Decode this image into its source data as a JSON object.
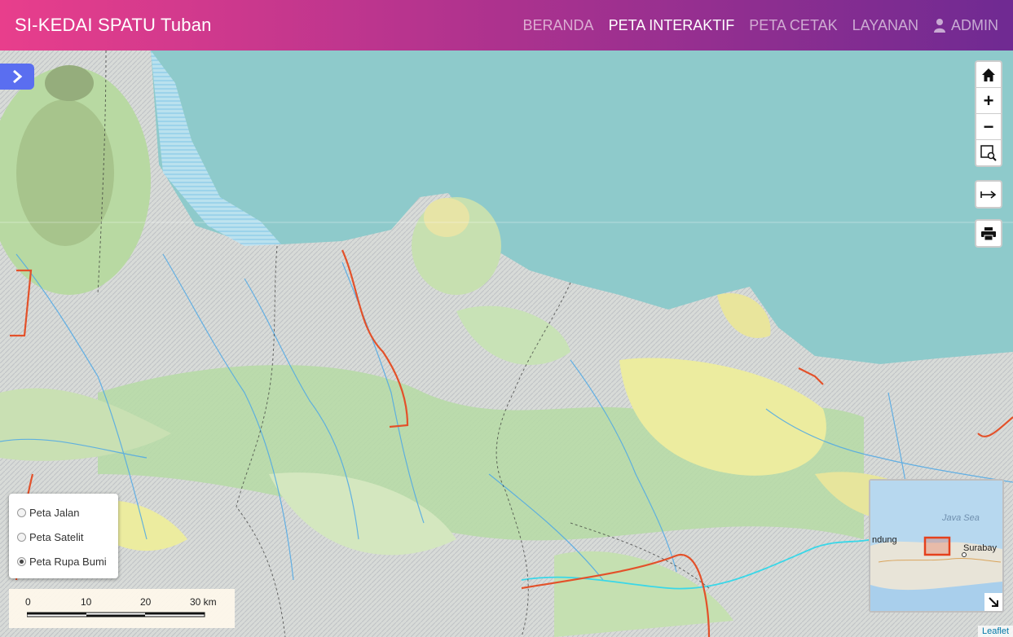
{
  "navbar": {
    "brand": "SI-KEDAI SPATU Tuban",
    "items": [
      {
        "label": "BERANDA",
        "active": false
      },
      {
        "label": "PETA INTERAKTIF",
        "active": true
      },
      {
        "label": "PETA CETAK",
        "active": false
      },
      {
        "label": "LAYANAN",
        "active": false
      },
      {
        "label": "ADMIN",
        "active": false,
        "icon": "user-icon"
      }
    ],
    "colors": {
      "gradient_start": "#e83e8c",
      "gradient_end": "#6f2a92"
    }
  },
  "map": {
    "sidebar_toggle_icon": "chevron-right-icon",
    "controls": {
      "home_icon": "home-icon",
      "zoom_in": "+",
      "zoom_out": "−",
      "zoom_box_icon": "zoom-box-icon",
      "measure_icon": "arrow-right-icon",
      "print_icon": "printer-icon"
    },
    "layers": [
      {
        "label": "Peta Jalan",
        "checked": false
      },
      {
        "label": "Peta Satelit",
        "checked": false
      },
      {
        "label": "Peta Rupa Bumi",
        "checked": true
      }
    ],
    "scale": {
      "labels": [
        "0",
        "10",
        "20",
        "30 km"
      ]
    },
    "minimap": {
      "labels": [
        "Java Sea",
        "ndung",
        "Surabay"
      ]
    },
    "attribution": "Leaflet",
    "colors": {
      "sea": "#8ecacb",
      "land": "#d9dbd6",
      "forest": "#b6dba4",
      "river": "#4ea8e6",
      "road": "#e3512a",
      "minimap_extent": "#e5401c"
    }
  }
}
